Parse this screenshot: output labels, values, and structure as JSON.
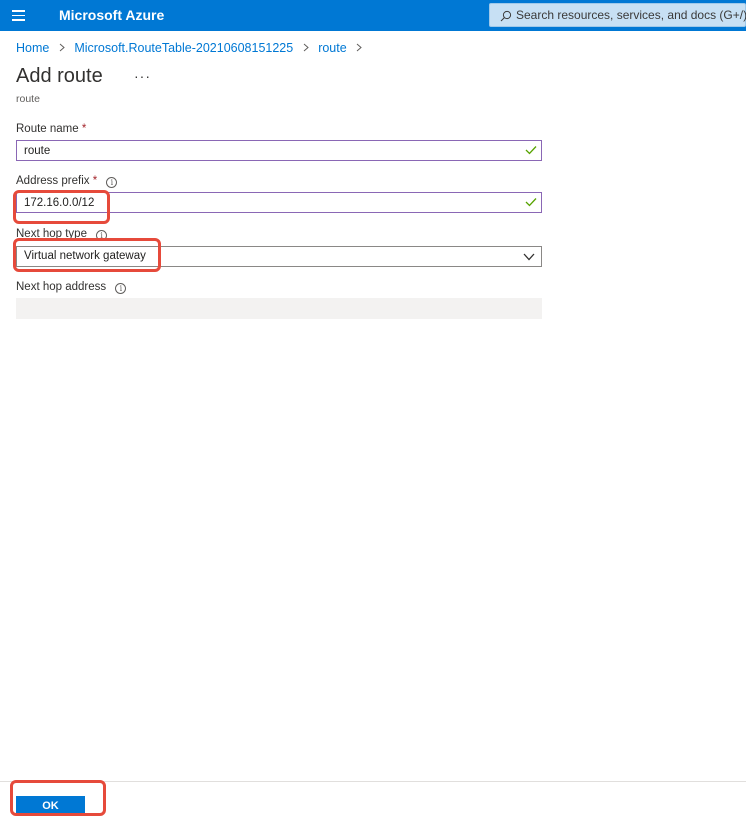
{
  "header": {
    "brand": "Microsoft Azure",
    "search_placeholder": "Search resources, services, and docs (G+/)",
    "search_icon": "search-icon",
    "menu_icon": "hamburger-menu-icon"
  },
  "breadcrumb": [
    "Home",
    "Microsoft.RouteTable-20210608151225",
    "route"
  ],
  "page": {
    "title": "Add route",
    "more": "···",
    "subtitle": "route"
  },
  "form": {
    "route_name": {
      "label": "Route name",
      "required": "*",
      "value": "route"
    },
    "address_prefix": {
      "label": "Address prefix",
      "required": "*",
      "value": "172.16.0.0/12"
    },
    "next_hop_type": {
      "label": "Next hop type",
      "value": "Virtual network gateway"
    },
    "next_hop_address": {
      "label": "Next hop address",
      "value": ""
    }
  },
  "footer": {
    "ok_label": "OK"
  },
  "colors": {
    "accent": "#0078d4",
    "highlight": "#e64a3b",
    "valid": "#57a300"
  }
}
